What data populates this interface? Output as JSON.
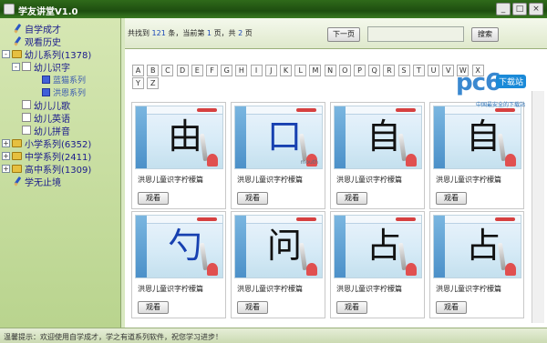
{
  "window": {
    "title": "学友讲堂V1.0",
    "controls": [
      "_",
      "□",
      "×"
    ]
  },
  "sidebar": {
    "items": [
      {
        "label": "自学成才",
        "kind": "pen"
      },
      {
        "label": "观看历史",
        "kind": "pen"
      },
      {
        "label": "幼儿系列(1378)",
        "kind": "folder",
        "expander": "-"
      },
      {
        "label": "幼儿识字",
        "kind": "book",
        "expander": "-"
      },
      {
        "label": "蓝猫系列",
        "kind": "leaf"
      },
      {
        "label": "洪恩系列",
        "kind": "leaf"
      },
      {
        "label": "幼儿儿歌",
        "kind": "book"
      },
      {
        "label": "幼儿英语",
        "kind": "book"
      },
      {
        "label": "幼儿拼音",
        "kind": "book"
      },
      {
        "label": "小学系列(6352)",
        "kind": "folder",
        "expander": "+"
      },
      {
        "label": "中学系列(2411)",
        "kind": "folder",
        "expander": "+"
      },
      {
        "label": "高中系列(1309)",
        "kind": "folder",
        "expander": "+"
      },
      {
        "label": "学无止境",
        "kind": "pen"
      }
    ]
  },
  "toolbar": {
    "found_prefix": "共找到",
    "found_count": "121",
    "found_mid": "条，当前第",
    "current_page": "1",
    "page_mid": "页，共",
    "total_pages": "2",
    "page_suffix": "页",
    "next_label": "下一页",
    "search_value": "",
    "search_label": "搜索"
  },
  "letters": [
    "A",
    "B",
    "C",
    "D",
    "E",
    "F",
    "G",
    "H",
    "I",
    "J",
    "K",
    "L",
    "M",
    "N",
    "O",
    "P",
    "Q",
    "R",
    "S",
    "T",
    "U",
    "V",
    "W",
    "X",
    "Y",
    "Z"
  ],
  "cards": [
    {
      "char": "由",
      "caption": "洪恩儿童识字柠檬篇",
      "button": "观看",
      "blue": false,
      "tag": ""
    },
    {
      "char": "口",
      "caption": "洪恩儿童识字柠檬篇",
      "button": "观看",
      "blue": true,
      "tag": "mouth"
    },
    {
      "char": "自",
      "caption": "洪恩儿童识字柠檬篇",
      "button": "观看",
      "blue": false,
      "tag": ""
    },
    {
      "char": "自",
      "caption": "洪恩儿童识字柠檬篇",
      "button": "观看",
      "blue": false,
      "tag": ""
    },
    {
      "char": "勺",
      "caption": "洪恩儿童识字柠檬篇",
      "button": "观看",
      "blue": true,
      "tag": ""
    },
    {
      "char": "问",
      "caption": "洪恩儿童识字柠檬篇",
      "button": "观看",
      "blue": false,
      "tag": ""
    },
    {
      "char": "占",
      "caption": "洪恩儿童识字柠檬篇",
      "button": "观看",
      "blue": false,
      "tag": ""
    },
    {
      "char": "占",
      "caption": "洪恩儿童识字柠檬篇",
      "button": "观看",
      "blue": false,
      "tag": ""
    }
  ],
  "status": {
    "text": "温馨提示：欢迎使用自学成才，学之有道系列软件，祝您学习进步！"
  },
  "watermark": {
    "brand": "pc6",
    "badge": "下载站",
    "slogan": "中国最安全的下载站"
  },
  "colors": {
    "titlebar": "#2f6a1a",
    "sidebar": "#c9dda4",
    "link_blue": "#1a1a8c",
    "count_blue": "#1a48b8"
  }
}
